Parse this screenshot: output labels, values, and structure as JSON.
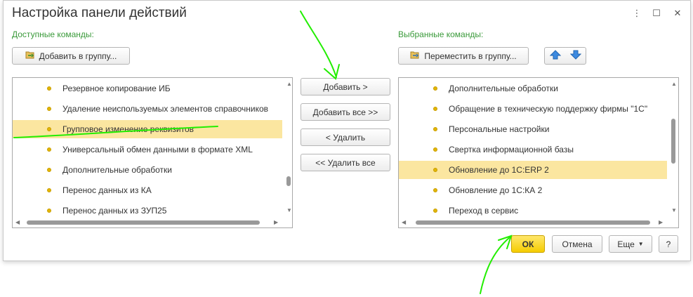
{
  "dialog": {
    "title": "Настройка панели действий",
    "controls": {
      "more": "⋮",
      "maximize": "☐",
      "close": "✕"
    }
  },
  "available": {
    "label": "Доступные команды:",
    "add_to_group": "Добавить в группу...",
    "items": [
      "Резервное копирование ИБ",
      "Удаление неиспользуемых элементов справочников",
      "Групповое изменение реквизитов",
      "Универсальный обмен данными в формате XML",
      "Дополнительные обработки",
      "Перенос данных из КА",
      "Перенос данных из ЗУП25"
    ],
    "selected_index": 2
  },
  "middle": {
    "add": "Добавить >",
    "add_all": "Добавить все >>",
    "remove": "< Удалить",
    "remove_all": "<< Удалить все"
  },
  "chosen": {
    "label": "Выбранные команды:",
    "move_to_group": "Переместить в группу...",
    "items": [
      "Дополнительные обработки",
      "Обращение в техническую поддержку фирмы \"1С\"",
      "Персональные настройки",
      "Свертка информационной базы",
      "Обновление до 1С:ERP 2",
      "Обновление до 1С:КА 2",
      "Переход в сервис"
    ],
    "selected_index": 4
  },
  "footer": {
    "ok": "ОК",
    "cancel": "Отмена",
    "more": "Еще",
    "help": "?"
  },
  "colors": {
    "section_label": "#3a9a3a",
    "selection": "#fbe6a0",
    "ok_button": "#f5cc00",
    "annotation": "#22ee00"
  },
  "icons": {
    "add_group": "folder-add-icon",
    "move_group": "folder-move-icon",
    "up": "arrow-up-icon",
    "down": "arrow-down-icon"
  }
}
